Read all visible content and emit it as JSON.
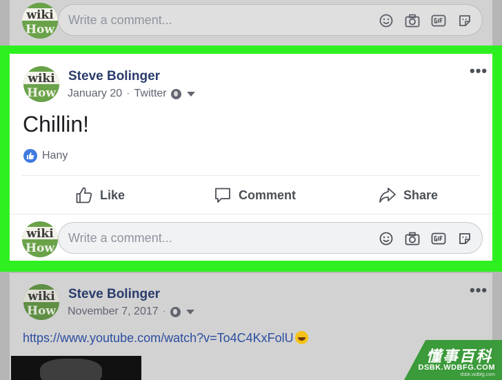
{
  "comment_placeholder": "Write a comment...",
  "avatar_text": {
    "line1": "wiki",
    "line2": "How"
  },
  "colors": {
    "highlight": "#2ef020",
    "name": "#2a3c6c",
    "link": "#2b4ea0",
    "like_badge": "#3f7be0"
  },
  "icons": [
    "emoji-icon",
    "camera-icon",
    "gif-icon",
    "sticker-icon",
    "globe-icon",
    "thumbs-up-icon",
    "speech-bubble-icon",
    "share-arrow-icon",
    "more-icon"
  ],
  "post": {
    "author": "Steve Bolinger",
    "date": "January 20",
    "separator": "·",
    "source": "Twitter",
    "text": "Chillin!",
    "reactions": "Hany",
    "actions": {
      "like": "Like",
      "comment": "Comment",
      "share": "Share"
    }
  },
  "next_post": {
    "author": "Steve Bolinger",
    "date": "November 7, 2017",
    "separator": "·",
    "link": "https://www.youtube.com/watch?v=To4C4KxFolU"
  },
  "watermark": {
    "cn": "懂事百科",
    "url": "DSBK.WDBFG.COM",
    "small": "dsbk.wdbfg.com"
  }
}
